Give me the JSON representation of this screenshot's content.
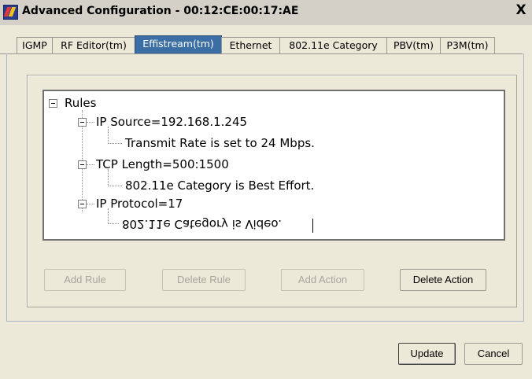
{
  "window": {
    "title": "Advanced Configuration - 00:12:CE:00:17:AE",
    "close_glyph": "X"
  },
  "tabs": [
    {
      "label": "IGMP"
    },
    {
      "label": "RF Editor(tm)"
    },
    {
      "label": "Effistream(tm)",
      "active": true
    },
    {
      "label": "Ethernet"
    },
    {
      "label": "802.11e Category"
    },
    {
      "label": "PBV(tm)"
    },
    {
      "label": "P3M(tm)"
    }
  ],
  "tree": {
    "root": "Rules",
    "nodes": [
      {
        "rule": "IP Source=192.168.1.245",
        "action": "Transmit Rate is set to 24 Mbps."
      },
      {
        "rule": "TCP Length=500:1500",
        "action": "802.11e Category is Best Effort."
      },
      {
        "rule": "IP Protocol=17",
        "action": "802.11e Category is Video."
      }
    ]
  },
  "buttons": {
    "add_rule": "Add Rule",
    "delete_rule": "Delete Rule",
    "add_action": "Add Action",
    "delete_action": "Delete Action",
    "update": "Update",
    "cancel": "Cancel"
  },
  "colors": {
    "active_tab": "#3a6ea5",
    "window_bg": "#ece9d8",
    "disabled_text": "#a8a59c"
  }
}
